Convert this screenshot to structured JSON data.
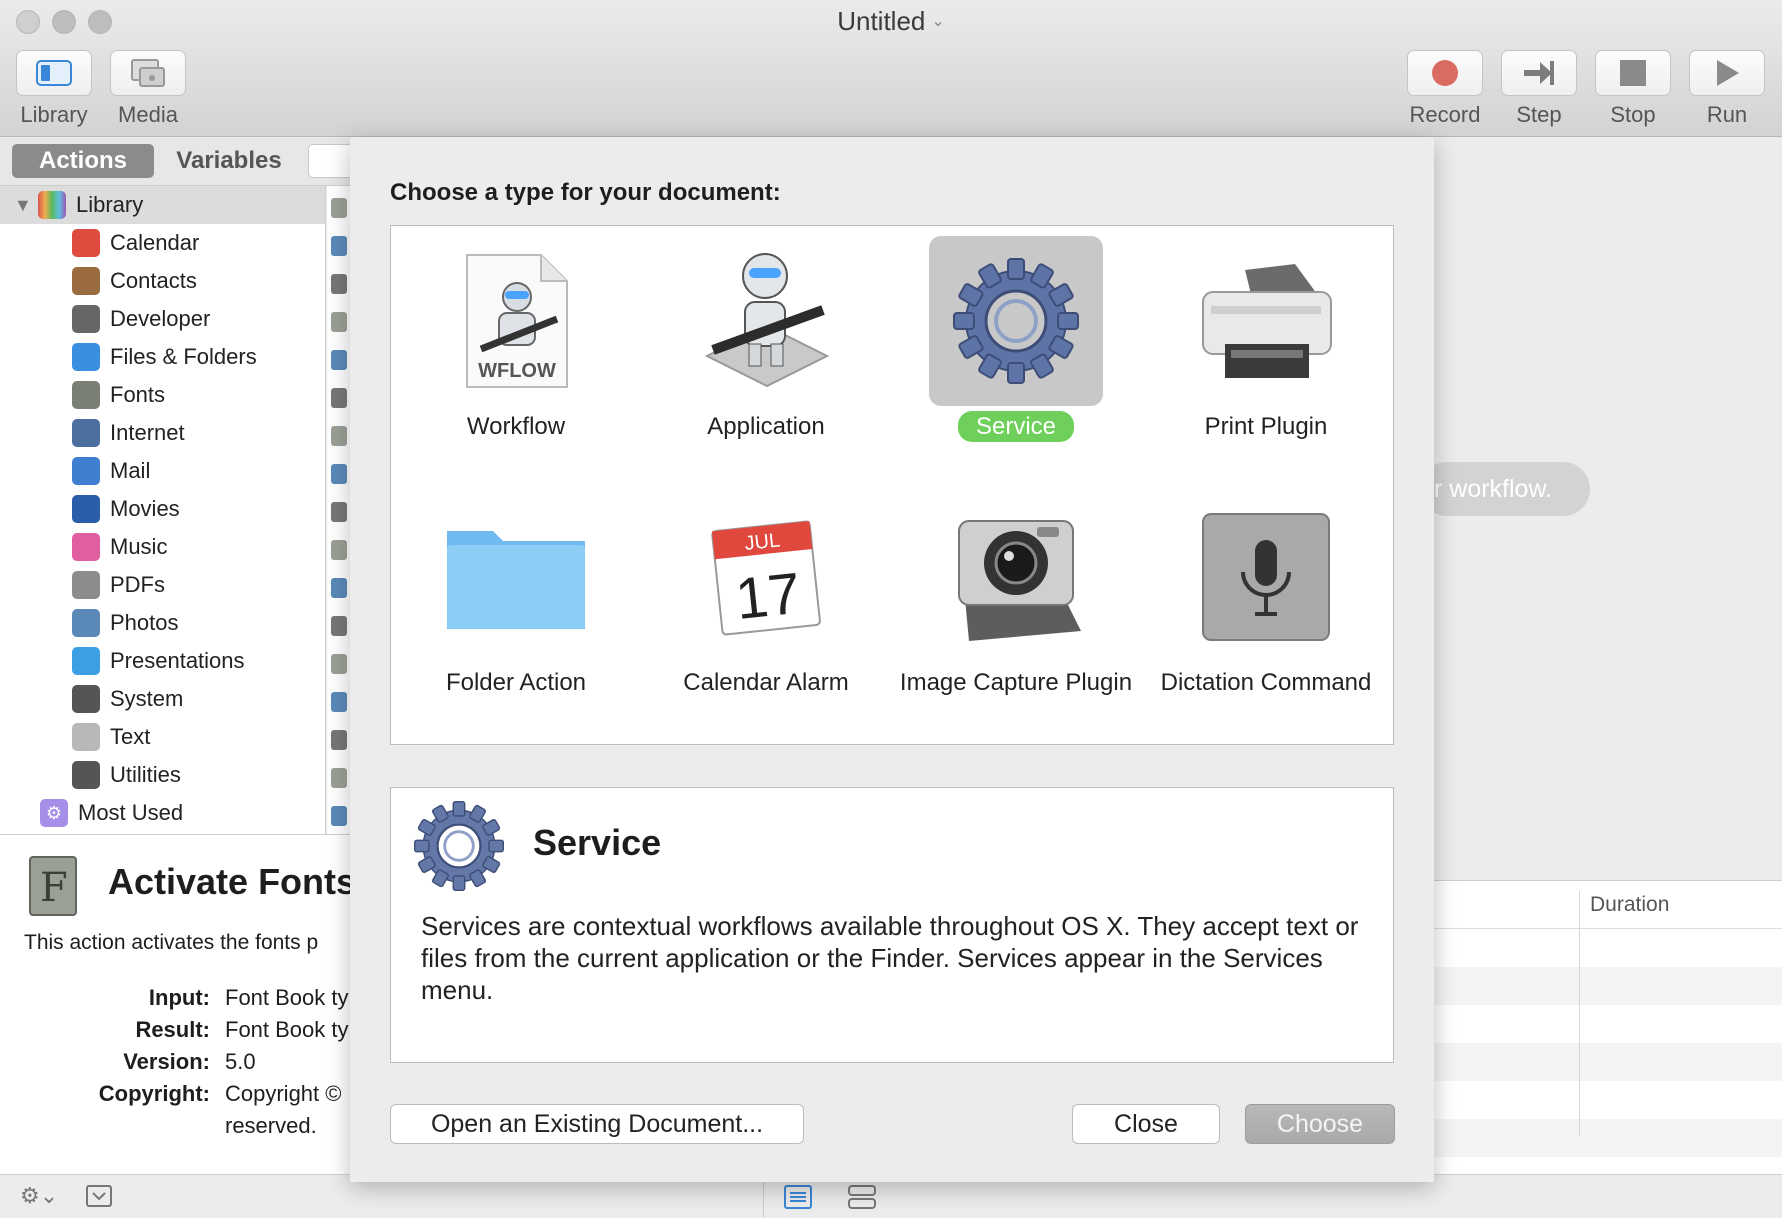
{
  "window": {
    "title": "Untitled"
  },
  "toolbar": {
    "left": [
      {
        "label": "Library",
        "icon": "library-sidebar-icon"
      },
      {
        "label": "Media",
        "icon": "media-icon"
      }
    ],
    "right": [
      {
        "label": "Record",
        "icon": "record-icon"
      },
      {
        "label": "Step",
        "icon": "step-icon"
      },
      {
        "label": "Stop",
        "icon": "stop-icon"
      },
      {
        "label": "Run",
        "icon": "run-icon"
      }
    ]
  },
  "library_tabs": {
    "actions": "Actions",
    "variables": "Variables"
  },
  "library": {
    "root": "Library",
    "items": [
      {
        "label": "Calendar",
        "color": "#e04b3f"
      },
      {
        "label": "Contacts",
        "color": "#9a6b3f"
      },
      {
        "label": "Developer",
        "color": "#666666"
      },
      {
        "label": "Files & Folders",
        "color": "#3b8fe0"
      },
      {
        "label": "Fonts",
        "color": "#7a7f76"
      },
      {
        "label": "Internet",
        "color": "#4d6fa0"
      },
      {
        "label": "Mail",
        "color": "#3f7fd1"
      },
      {
        "label": "Movies",
        "color": "#2b5ea8"
      },
      {
        "label": "Music",
        "color": "#e05fa0"
      },
      {
        "label": "PDFs",
        "color": "#8c8c8c"
      },
      {
        "label": "Photos",
        "color": "#5a89b8"
      },
      {
        "label": "Presentations",
        "color": "#3d9fe3"
      },
      {
        "label": "System",
        "color": "#555555"
      },
      {
        "label": "Text",
        "color": "#b8b8b8"
      },
      {
        "label": "Utilities",
        "color": "#555555"
      }
    ],
    "most_used": "Most Used"
  },
  "action_description": {
    "title": "Activate Fonts",
    "text": "This action activates the fonts p",
    "fields": [
      {
        "key": "Input:",
        "value": "Font Book ty"
      },
      {
        "key": "Result:",
        "value": "Font Book ty"
      },
      {
        "key": "Version:",
        "value": "5.0"
      },
      {
        "key": "Copyright:",
        "value": "Copyright ©"
      },
      {
        "key": "",
        "value": "reserved."
      }
    ]
  },
  "workflow_hint": "r workflow.",
  "log": {
    "duration_header": "Duration"
  },
  "sheet": {
    "prompt": "Choose a type for your document:",
    "types": [
      {
        "label": "Workflow",
        "icon": "workflow-document-icon",
        "selected": false
      },
      {
        "label": "Application",
        "icon": "automator-robot-icon",
        "selected": false
      },
      {
        "label": "Service",
        "icon": "gear-icon",
        "selected": true
      },
      {
        "label": "Print Plugin",
        "icon": "printer-icon",
        "selected": false
      },
      {
        "label": "Folder Action",
        "icon": "folder-icon",
        "selected": false
      },
      {
        "label": "Calendar Alarm",
        "icon": "calendar-icon",
        "selected": false
      },
      {
        "label": "Image Capture Plugin",
        "icon": "camera-icon",
        "selected": false
      },
      {
        "label": "Dictation Command",
        "icon": "microphone-icon",
        "selected": false
      }
    ],
    "workflow_badge": "WFLOW",
    "calendar_month": "JUL",
    "calendar_day": "17",
    "description": {
      "title": "Service",
      "text": "Services are contextual workflows available throughout OS X. They accept text or files from the current application or the Finder. Services appear in the Services menu."
    },
    "buttons": {
      "open": "Open an Existing Document...",
      "close": "Close",
      "choose": "Choose"
    }
  }
}
